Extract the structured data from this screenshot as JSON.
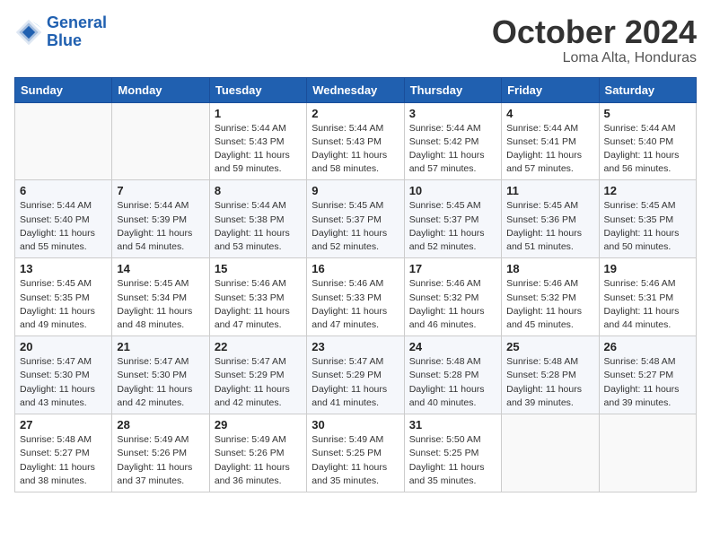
{
  "header": {
    "logo_line1": "General",
    "logo_line2": "Blue",
    "month": "October 2024",
    "location": "Loma Alta, Honduras"
  },
  "weekdays": [
    "Sunday",
    "Monday",
    "Tuesday",
    "Wednesday",
    "Thursday",
    "Friday",
    "Saturday"
  ],
  "weeks": [
    [
      {
        "day": "",
        "info": ""
      },
      {
        "day": "",
        "info": ""
      },
      {
        "day": "1",
        "info": "Sunrise: 5:44 AM\nSunset: 5:43 PM\nDaylight: 11 hours and 59 minutes."
      },
      {
        "day": "2",
        "info": "Sunrise: 5:44 AM\nSunset: 5:43 PM\nDaylight: 11 hours and 58 minutes."
      },
      {
        "day": "3",
        "info": "Sunrise: 5:44 AM\nSunset: 5:42 PM\nDaylight: 11 hours and 57 minutes."
      },
      {
        "day": "4",
        "info": "Sunrise: 5:44 AM\nSunset: 5:41 PM\nDaylight: 11 hours and 57 minutes."
      },
      {
        "day": "5",
        "info": "Sunrise: 5:44 AM\nSunset: 5:40 PM\nDaylight: 11 hours and 56 minutes."
      }
    ],
    [
      {
        "day": "6",
        "info": "Sunrise: 5:44 AM\nSunset: 5:40 PM\nDaylight: 11 hours and 55 minutes."
      },
      {
        "day": "7",
        "info": "Sunrise: 5:44 AM\nSunset: 5:39 PM\nDaylight: 11 hours and 54 minutes."
      },
      {
        "day": "8",
        "info": "Sunrise: 5:44 AM\nSunset: 5:38 PM\nDaylight: 11 hours and 53 minutes."
      },
      {
        "day": "9",
        "info": "Sunrise: 5:45 AM\nSunset: 5:37 PM\nDaylight: 11 hours and 52 minutes."
      },
      {
        "day": "10",
        "info": "Sunrise: 5:45 AM\nSunset: 5:37 PM\nDaylight: 11 hours and 52 minutes."
      },
      {
        "day": "11",
        "info": "Sunrise: 5:45 AM\nSunset: 5:36 PM\nDaylight: 11 hours and 51 minutes."
      },
      {
        "day": "12",
        "info": "Sunrise: 5:45 AM\nSunset: 5:35 PM\nDaylight: 11 hours and 50 minutes."
      }
    ],
    [
      {
        "day": "13",
        "info": "Sunrise: 5:45 AM\nSunset: 5:35 PM\nDaylight: 11 hours and 49 minutes."
      },
      {
        "day": "14",
        "info": "Sunrise: 5:45 AM\nSunset: 5:34 PM\nDaylight: 11 hours and 48 minutes."
      },
      {
        "day": "15",
        "info": "Sunrise: 5:46 AM\nSunset: 5:33 PM\nDaylight: 11 hours and 47 minutes."
      },
      {
        "day": "16",
        "info": "Sunrise: 5:46 AM\nSunset: 5:33 PM\nDaylight: 11 hours and 47 minutes."
      },
      {
        "day": "17",
        "info": "Sunrise: 5:46 AM\nSunset: 5:32 PM\nDaylight: 11 hours and 46 minutes."
      },
      {
        "day": "18",
        "info": "Sunrise: 5:46 AM\nSunset: 5:32 PM\nDaylight: 11 hours and 45 minutes."
      },
      {
        "day": "19",
        "info": "Sunrise: 5:46 AM\nSunset: 5:31 PM\nDaylight: 11 hours and 44 minutes."
      }
    ],
    [
      {
        "day": "20",
        "info": "Sunrise: 5:47 AM\nSunset: 5:30 PM\nDaylight: 11 hours and 43 minutes."
      },
      {
        "day": "21",
        "info": "Sunrise: 5:47 AM\nSunset: 5:30 PM\nDaylight: 11 hours and 42 minutes."
      },
      {
        "day": "22",
        "info": "Sunrise: 5:47 AM\nSunset: 5:29 PM\nDaylight: 11 hours and 42 minutes."
      },
      {
        "day": "23",
        "info": "Sunrise: 5:47 AM\nSunset: 5:29 PM\nDaylight: 11 hours and 41 minutes."
      },
      {
        "day": "24",
        "info": "Sunrise: 5:48 AM\nSunset: 5:28 PM\nDaylight: 11 hours and 40 minutes."
      },
      {
        "day": "25",
        "info": "Sunrise: 5:48 AM\nSunset: 5:28 PM\nDaylight: 11 hours and 39 minutes."
      },
      {
        "day": "26",
        "info": "Sunrise: 5:48 AM\nSunset: 5:27 PM\nDaylight: 11 hours and 39 minutes."
      }
    ],
    [
      {
        "day": "27",
        "info": "Sunrise: 5:48 AM\nSunset: 5:27 PM\nDaylight: 11 hours and 38 minutes."
      },
      {
        "day": "28",
        "info": "Sunrise: 5:49 AM\nSunset: 5:26 PM\nDaylight: 11 hours and 37 minutes."
      },
      {
        "day": "29",
        "info": "Sunrise: 5:49 AM\nSunset: 5:26 PM\nDaylight: 11 hours and 36 minutes."
      },
      {
        "day": "30",
        "info": "Sunrise: 5:49 AM\nSunset: 5:25 PM\nDaylight: 11 hours and 35 minutes."
      },
      {
        "day": "31",
        "info": "Sunrise: 5:50 AM\nSunset: 5:25 PM\nDaylight: 11 hours and 35 minutes."
      },
      {
        "day": "",
        "info": ""
      },
      {
        "day": "",
        "info": ""
      }
    ]
  ]
}
